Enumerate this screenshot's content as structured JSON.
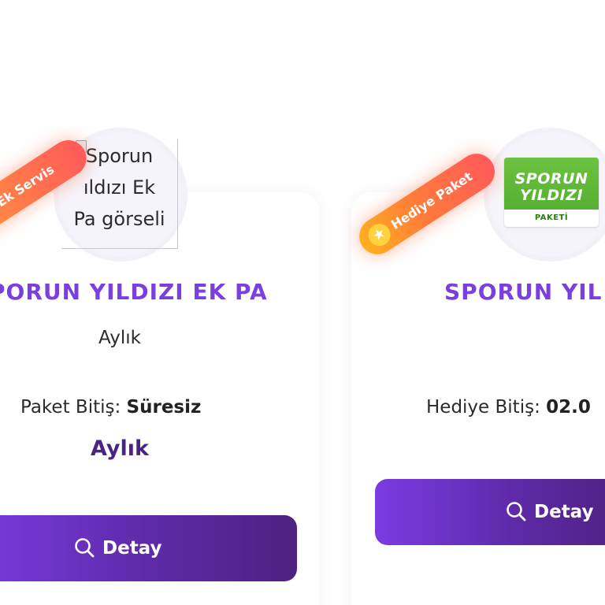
{
  "cards": [
    {
      "ribbon": "ı Ek Servis",
      "image_alt_text": "Sporun Yıldızı Ek Pa görseli",
      "image_alt_lines": [
        "Sporun",
        "ıldızı Ek",
        "Pa görseli"
      ],
      "title": "PORUN YILDIZI EK PA",
      "period": "Aylık",
      "end_label": "Paket Bitiş:",
      "end_value": "Süresiz",
      "period_strong": "Aylık",
      "button": "Detay",
      "button_icon": "search-icon"
    },
    {
      "ribbon": "Hediye Paket",
      "ribbon_icon": "star-icon",
      "logo": {
        "line1": "SPORUN",
        "line2": "YILDIZI",
        "band": "PAKETİ",
        "color": "#5bb535"
      },
      "title": "SPORUN YIL",
      "end_label": "Hediye Bitiş:",
      "end_value": "02.0",
      "button": "Detay",
      "button_icon": "search-icon"
    }
  ],
  "colors": {
    "title": "#7b3fe0",
    "button_gradient_start": "#7b3be2",
    "button_gradient_end": "#4e2180",
    "ribbon_orange": "#ff9a3c",
    "ribbon_red": "#ff5a5a"
  }
}
